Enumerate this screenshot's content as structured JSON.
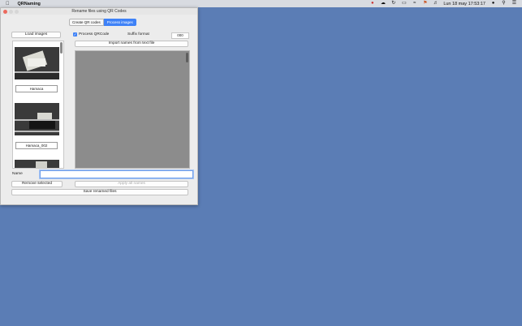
{
  "menubar": {
    "app_name": "QRNaming",
    "apple_icon": "apple-icon",
    "status_icons": [
      "creative-cloud-icon",
      "cloud-icon",
      "time-machine-icon",
      "airplay-icon",
      "wifi-icon",
      "flag-icon",
      "volume-icon"
    ],
    "datetime": "Lun 18 may  17:53:17",
    "right_icons": [
      "user-icon",
      "search-icon",
      "menu-icon"
    ]
  },
  "window": {
    "title": "Rename files using QR Codes",
    "tabs": [
      "Create QR codes",
      "Process images"
    ],
    "active_tab": "Process images"
  },
  "left_panel": {
    "load_button": "Load images",
    "thumbnails": [
      {
        "label": "Hamaca"
      },
      {
        "label": "Hamaca_002"
      }
    ]
  },
  "options": {
    "process_qrcode_label": "Process QRCode",
    "process_qrcode_checked": true,
    "suffix_label": "Suffix format",
    "suffix_value": "000",
    "import_button": "Import names from text file"
  },
  "form": {
    "name_label": "Name",
    "name_value": "",
    "remove_button": "Remove selected",
    "apply_button": "Apply all names",
    "save_button": "Save renamed files"
  }
}
